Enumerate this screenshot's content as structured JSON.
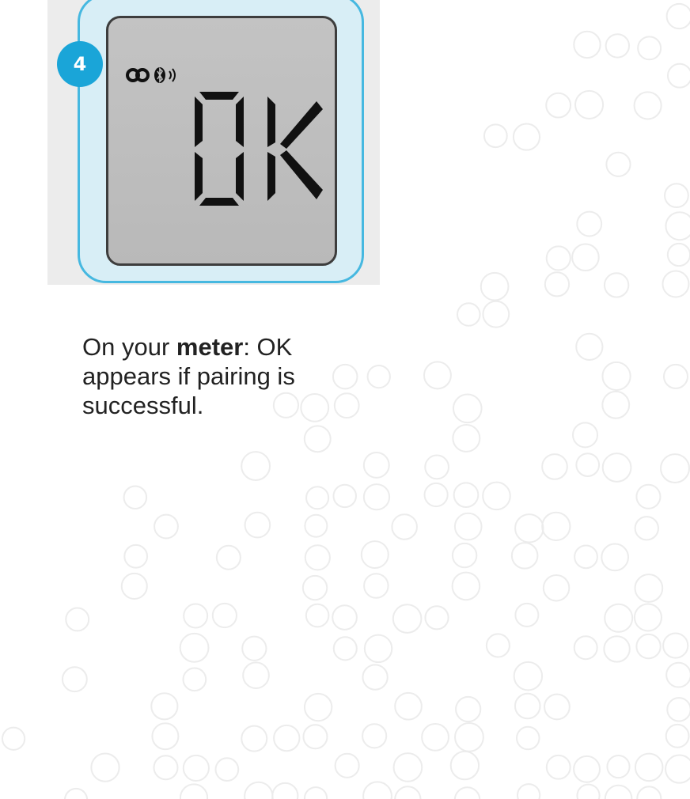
{
  "step": {
    "number": "4"
  },
  "display": {
    "text": "OK",
    "icons": [
      "link-icon",
      "bluetooth-icon",
      "signal-icon"
    ]
  },
  "caption": {
    "prefix": "On your ",
    "emphasis": "meter",
    "suffix": ": OK appears if pairing is successful."
  },
  "colors": {
    "accent": "#1aa5d8",
    "frame_border": "#46b8e0",
    "lcd_background": "#bcbcbc",
    "lcd_segment": "#111111",
    "text": "#222222"
  }
}
